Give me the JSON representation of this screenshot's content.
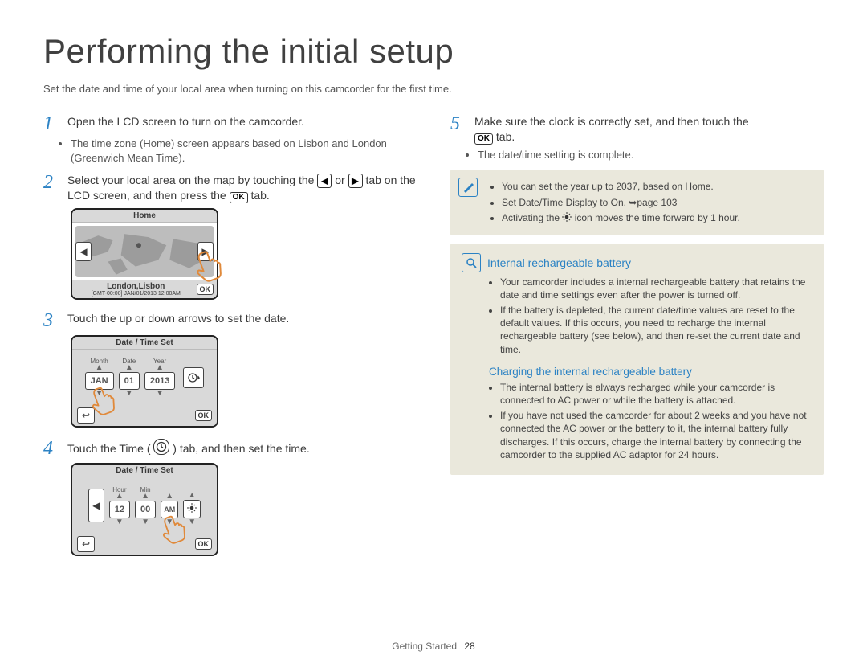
{
  "title": "Performing the initial setup",
  "intro": "Set the date and time of your local area when turning on this camcorder for the first time.",
  "left": {
    "step1": {
      "num": "1",
      "text_a": "Open the LCD screen to turn on the camcorder.",
      "bullet1_a": "The time zone (",
      "bullet1_b": "Home",
      "bullet1_c": ") screen appears based on Lisbon and London (Greenwich Mean Time)."
    },
    "step2": {
      "num": "2",
      "text_a": "Select your local area on the map by touching the ",
      "text_b": " or ",
      "text_c": " tab on the LCD screen, and then press the ",
      "text_d": " tab."
    },
    "lcd1": {
      "header": "Home",
      "city": "London,Lisbon",
      "stamp": "[GMT-00:00] JAN/01/2013 12:00AM",
      "ok": "OK"
    },
    "step3": {
      "num": "3",
      "text": "Touch the up or down arrows to set the date."
    },
    "lcd2": {
      "header": "Date / Time Set",
      "labels": {
        "m": "Month",
        "d": "Date",
        "y": "Year"
      },
      "vals": {
        "m": "JAN",
        "d": "01",
        "y": "2013"
      },
      "ok": "OK"
    },
    "step4": {
      "num": "4",
      "text_a": "Touch the Time (",
      "text_b": ") tab, and then set the time."
    },
    "lcd3": {
      "header": "Date / Time Set",
      "labels": {
        "h": "Hour",
        "m": "Min"
      },
      "vals": {
        "h": "12",
        "m": "00",
        "ampm": "AM"
      },
      "ok": "OK"
    }
  },
  "right": {
    "step5": {
      "num": "5",
      "text_a": "Make sure the clock is correctly set, and then touch the ",
      "text_b": " tab.",
      "bullet": "The date/time setting is complete."
    },
    "info": {
      "l1_a": "You can set the year up to 2037, based on ",
      "l1_b": "Home",
      "l1_c": ".",
      "l2_a": "Set ",
      "l2_b": "Date/Time Display",
      "l2_c": " to On. ",
      "l2_d": "page 103",
      "l3_a": "Activating the ",
      "l3_b": " icon moves the time forward by 1 hour."
    },
    "box": {
      "h1": "Internal rechargeable battery",
      "b1": "Your camcorder includes a internal rechargeable battery that retains the date and time settings even after the power is turned off.",
      "b2": "If the battery is depleted, the current date/time values are reset to the default values. If this occurs, you need to recharge the internal rechargeable battery (see below), and then re-set the current date and time.",
      "h2": "Charging the internal rechargeable battery",
      "b3": "The internal battery is always recharged while your camcorder is connected to AC power or while the battery is attached.",
      "b4": "If you have not used the camcorder for about 2 weeks and you have not connected the AC power or the battery to it, the internal battery fully discharges. If this occurs, charge the internal battery by connecting the camcorder to the supplied AC adaptor for 24 hours."
    }
  },
  "footer": {
    "section": "Getting Started",
    "page": "28"
  },
  "tabs": {
    "ok": "OK",
    "left": "◀",
    "right": "▶"
  }
}
